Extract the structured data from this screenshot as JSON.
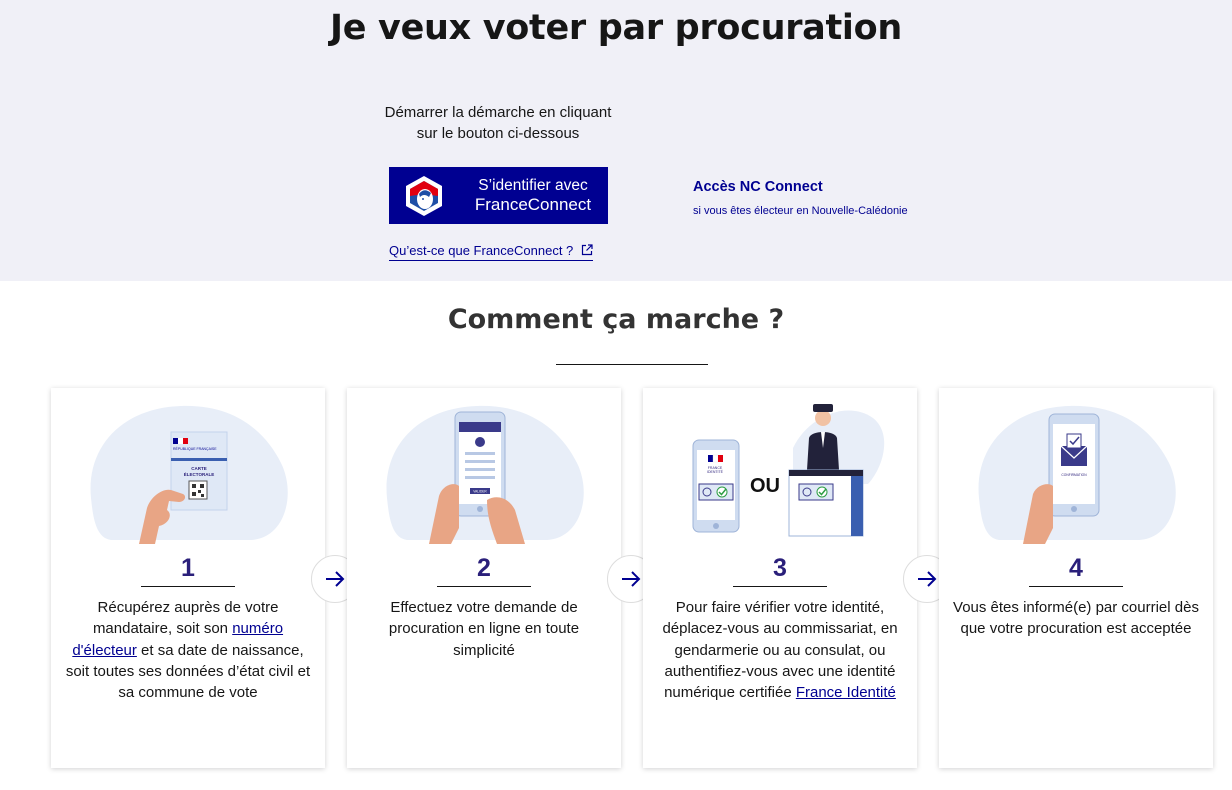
{
  "hero": {
    "title": "Je veux voter par procuration",
    "instructions_line1": "Démarrer la démarche en cliquant",
    "instructions_line2": "sur le bouton ci-dessous",
    "franceconnect_button": {
      "line1": "S’identifier avec",
      "line2": "FranceConnect"
    },
    "franceconnect_help_link": "Qu’est-ce que FranceConnect ?",
    "nc_connect": {
      "title": "Accès NC Connect",
      "subtitle": "si vous êtes électeur en Nouvelle-Calédonie"
    }
  },
  "how_it_works": {
    "title": "Comment ça marche ?",
    "steps": [
      {
        "number": "1",
        "text_before": "Récupérez auprès de votre mandataire, soit son ",
        "link": "numéro d'électeur",
        "text_after": " et sa date de naissance, soit toutes ses données d’état civil et sa commune de vote",
        "illustration": {
          "card_top": "RÉPUBLIQUE FRANÇAISE",
          "card_title_1": "CARTE",
          "card_title_2": "ÉLECTORALE"
        }
      },
      {
        "number": "2",
        "text": "Effectuez votre demande de procuration en ligne en toute simplicité",
        "illustration": {
          "button_label": "VALIDER"
        }
      },
      {
        "number": "3",
        "text_before": "Pour faire vérifier votre identité, déplacez-vous au commissariat, en gendarmerie ou au consulat, ou authentifiez-vous avec une identité numérique certifiée ",
        "link": "France Identité",
        "text_after": "",
        "illustration": {
          "or_label": "OU",
          "phone_label_1": "FRANCE",
          "phone_label_2": "IDENTITÉ"
        }
      },
      {
        "number": "4",
        "text": "Vous êtes informé(e) par courriel dès que votre procuration est acceptée",
        "illustration": {
          "envelope_label": "CONFIRMATION"
        }
      }
    ]
  },
  "colors": {
    "primary": "#000091",
    "hero_bg": "#f0f0f7",
    "step_number": "#2a1f7a",
    "illustration_blob": "#e8eef8",
    "hand": "#e8a585"
  },
  "icons": [
    "france-connect-logo-icon",
    "external-link-icon",
    "arrow-right-icon"
  ]
}
